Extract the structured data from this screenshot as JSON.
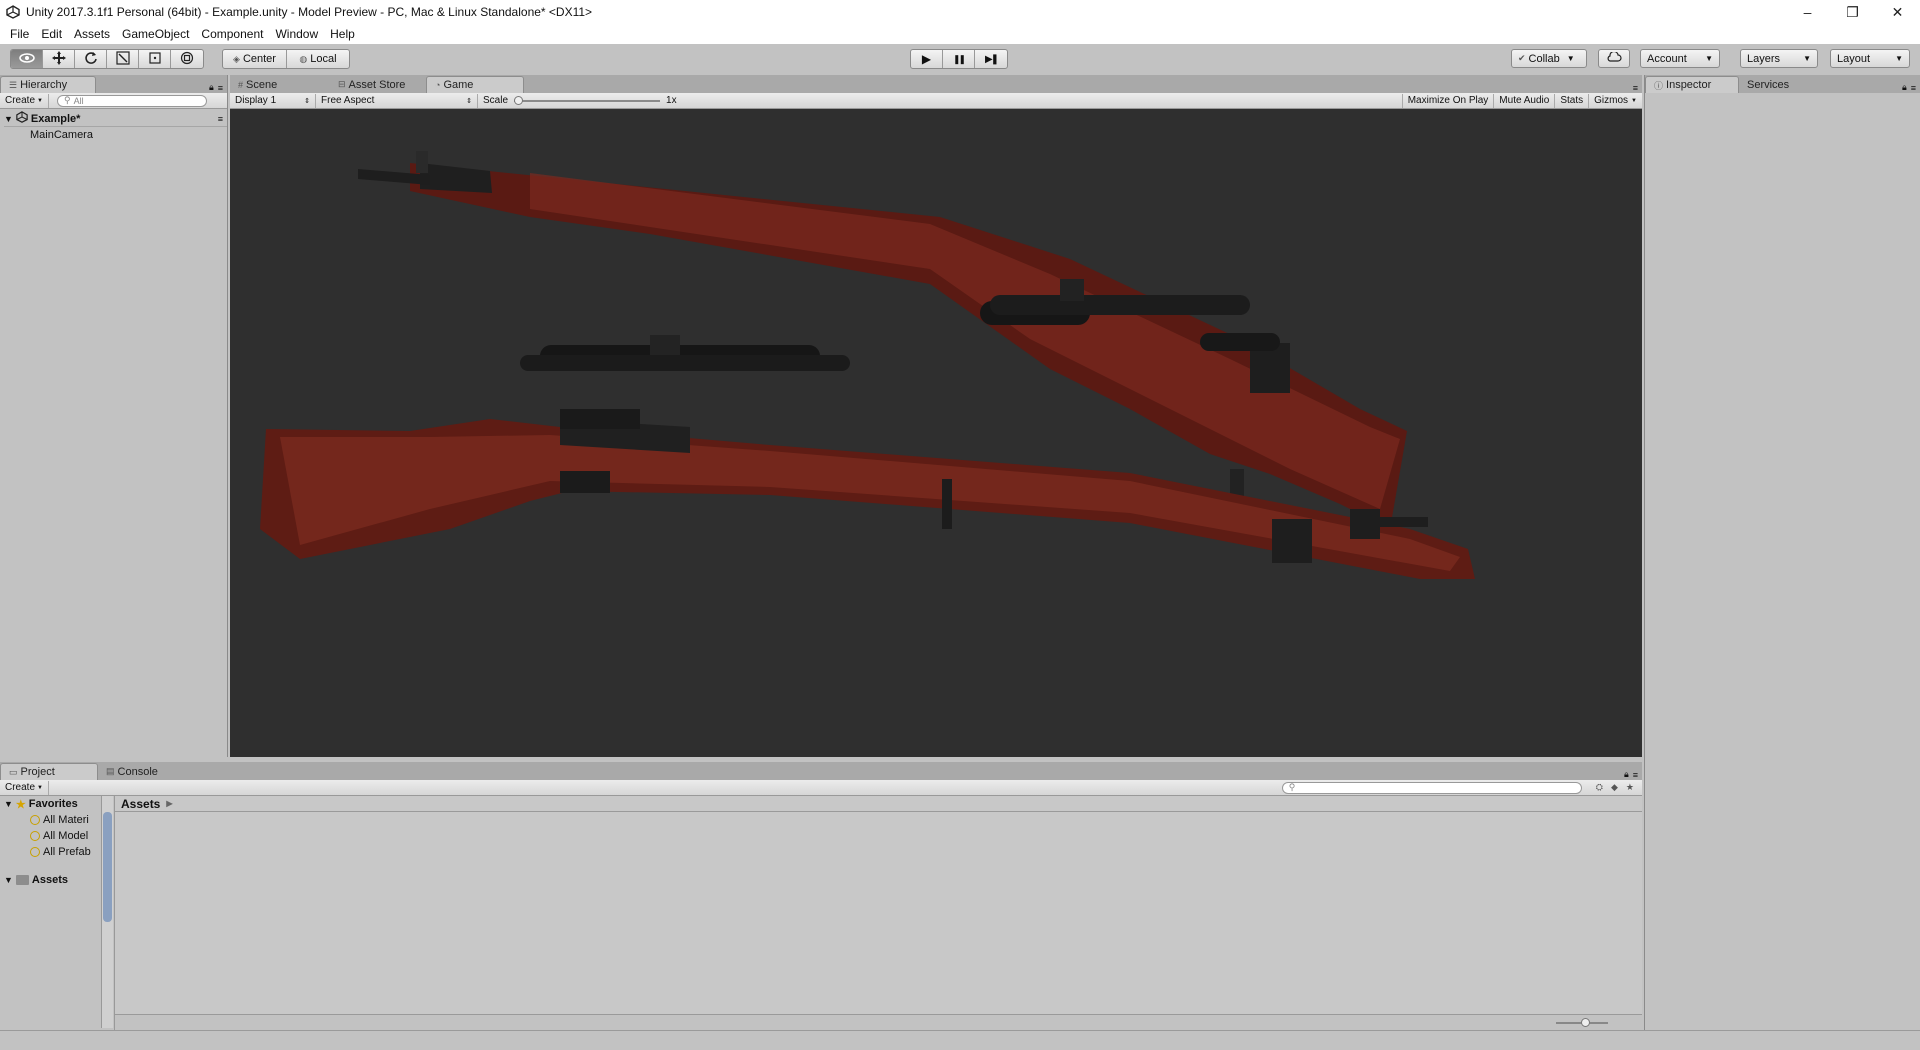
{
  "window": {
    "title": "Unity 2017.3.1f1 Personal (64bit) - Example.unity - Model Preview - PC, Mac & Linux Standalone* <DX11>",
    "controls": {
      "minimize": "–",
      "restore": "❐",
      "close": "✕"
    }
  },
  "menubar": {
    "items": [
      "File",
      "Edit",
      "Assets",
      "GameObject",
      "Component",
      "Window",
      "Help"
    ]
  },
  "toolbar": {
    "transform_tools": [
      "eye-icon",
      "move-icon",
      "rotate-icon",
      "scale-icon",
      "rect-icon",
      "transform-icon"
    ],
    "pivot": "Center",
    "space": "Local",
    "play_icon": "▶",
    "pause_icon": "❚❚",
    "step_icon": "▶❚",
    "collab": "Collab",
    "account": "Account",
    "layers": "Layers",
    "layout": "Layout"
  },
  "hierarchy": {
    "tab": "Hierarchy",
    "create": "Create",
    "search_placeholder": "All",
    "scene": "Example*",
    "items": [
      "MainCamera"
    ]
  },
  "center_tabs": {
    "scene": "Scene",
    "asset_store": "Asset Store",
    "game": "Game"
  },
  "game_toolbar": {
    "display": "Display 1",
    "aspect": "Free Aspect",
    "scale_label": "Scale",
    "scale_value": "1x",
    "scale_level": 0.0,
    "maximize": "Maximize On Play",
    "mute": "Mute Audio",
    "stats": "Stats",
    "gizmos": "Gizmos"
  },
  "inspector": {
    "tab": "Inspector",
    "services": "Services"
  },
  "project": {
    "tab": "Project",
    "console": "Console",
    "create": "Create",
    "favorites": "Favorites",
    "fav_items": [
      "All Materi",
      "All Model",
      "All Prefab"
    ],
    "assets_root": "Assets",
    "breadcrumb": "Assets"
  },
  "colors": {
    "editor_bg": "#c2c2c2",
    "game_bg": "#2f2f2f",
    "wood": "#6a1e16",
    "metal": "#1c1c1c"
  }
}
